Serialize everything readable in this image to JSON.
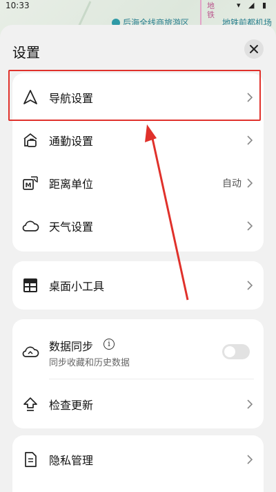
{
  "status": {
    "time": "10:33",
    "icons": "▾ ◢ ▮"
  },
  "map": {
    "label_scenic": "后海全线商旅游区",
    "label_metro": "地铁",
    "label_station": "地铁前都机场"
  },
  "sheet": {
    "title": "设置",
    "close_icon": "close-icon"
  },
  "group1": {
    "items": [
      {
        "label": "导航设置",
        "icon": "navigation-arrow-icon"
      },
      {
        "label": "通勤设置",
        "icon": "commute-briefcase-icon"
      },
      {
        "label": "距离单位",
        "icon": "distance-unit-icon",
        "value": "自动"
      },
      {
        "label": "天气设置",
        "icon": "cloud-weather-icon"
      }
    ]
  },
  "group2": {
    "items": [
      {
        "label": "桌面小工具",
        "icon": "widget-icon"
      }
    ]
  },
  "group3": {
    "sync": {
      "label": "数据同步",
      "sub": "同步收藏和历史数据",
      "info_icon": "info-icon",
      "enabled": false
    },
    "update": {
      "label": "检查更新",
      "icon": "upload-arrow-icon"
    }
  },
  "group4": {
    "items": [
      {
        "label": "隐私管理",
        "icon": "privacy-document-icon"
      }
    ]
  },
  "annotation": {
    "highlight_color": "#e0312b"
  }
}
